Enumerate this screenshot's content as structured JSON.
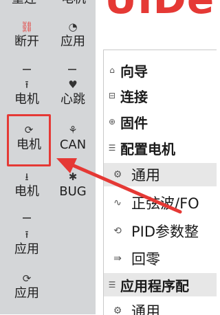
{
  "sidebar": {
    "top_cutoff": {
      "left": "重连",
      "right": "电机"
    },
    "items": [
      {
        "label": "断开",
        "icon": "disconnect-link-icon",
        "glyph": "⛓"
      },
      {
        "label": "应用",
        "icon": "gauge-icon",
        "glyph": "◔"
      },
      {
        "label": "电机",
        "icon": "upload-arrow-icon",
        "glyph": "⭱"
      },
      {
        "label": "心跳",
        "icon": "heartbeat-icon",
        "glyph": "♥"
      },
      {
        "label": "电机",
        "icon": "refresh-icon",
        "glyph": "⟳"
      },
      {
        "label": "CAN",
        "icon": "can-network-icon",
        "glyph": "⚘"
      },
      {
        "label": "电机",
        "icon": "download-arrow-icon",
        "glyph": "⭳"
      },
      {
        "label": "BUG",
        "icon": "bug-icon",
        "glyph": "✱"
      },
      {
        "label": "应用",
        "icon": "upload-arrow-icon",
        "glyph": "⭱"
      },
      {
        "label": "应用",
        "icon": "refresh-icon",
        "glyph": "⟳"
      }
    ]
  },
  "logo_text": "UIDe",
  "tree": {
    "rows": [
      {
        "label": "向导",
        "icon": "home-icon",
        "glyph": "⌂",
        "kind": "hdr"
      },
      {
        "label": "连接",
        "icon": "connect-icon",
        "glyph": "⊟",
        "kind": "hdr"
      },
      {
        "label": "固件",
        "icon": "firmware-icon",
        "glyph": "⊕",
        "kind": "hdr"
      },
      {
        "label": "配置电机",
        "icon": "list-icon",
        "glyph": "☰",
        "kind": "hdr"
      },
      {
        "label": "通用",
        "icon": "gear-icon",
        "glyph": "⚙",
        "kind": "child sel"
      },
      {
        "label": "正弦波/FO",
        "icon": "sine-wave-icon",
        "glyph": "∿",
        "kind": "child"
      },
      {
        "label": "PID参数整",
        "icon": "pid-icon",
        "glyph": "⟲",
        "kind": "child"
      },
      {
        "label": "回零",
        "icon": "homing-icon",
        "glyph": "⇛",
        "kind": "child"
      },
      {
        "label": "应用程序配",
        "icon": "list-icon",
        "glyph": "☰",
        "kind": "hdr sel"
      },
      {
        "label": "通用",
        "icon": "gear-icon",
        "glyph": "⚙",
        "kind": "child"
      }
    ]
  },
  "colors": {
    "accent_red": "#e53935",
    "sidebar_bg": "#d4d6d8"
  }
}
